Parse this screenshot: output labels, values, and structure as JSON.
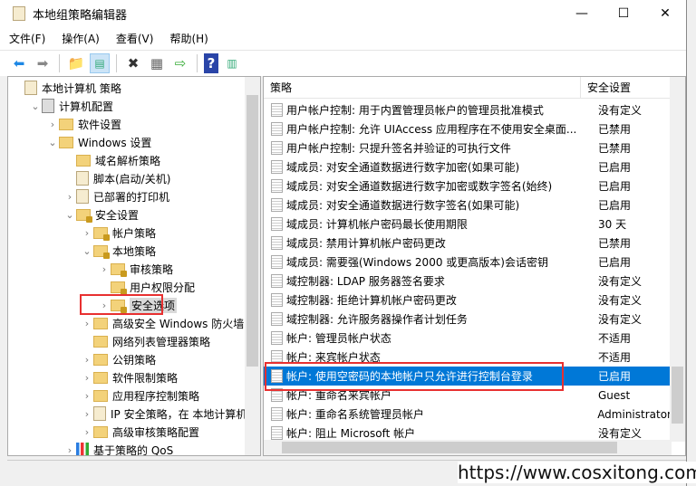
{
  "window": {
    "title": "本地组策略编辑器",
    "minimize": "—",
    "maximize": "☐",
    "close": "✕"
  },
  "menu": [
    "文件(F)",
    "操作(A)",
    "查看(V)",
    "帮助(H)"
  ],
  "toolbar": [
    "back-icon",
    "forward-icon",
    "up-folder-icon",
    "show-hide-tree-icon",
    "delete-icon",
    "properties-icon",
    "export-list-icon",
    "help-icon",
    "show-hide-action-pane-icon"
  ],
  "tree": [
    {
      "label": "本地计算机 策略",
      "level": 0,
      "chevron": "",
      "icon": "doc"
    },
    {
      "label": "计算机配置",
      "level": 1,
      "chevron": "expanded",
      "icon": "computer"
    },
    {
      "label": "软件设置",
      "level": 2,
      "chevron": "collapsed",
      "icon": "folder"
    },
    {
      "label": "Windows 设置",
      "level": 2,
      "chevron": "expanded",
      "icon": "folder"
    },
    {
      "label": "域名解析策略",
      "level": 3,
      "chevron": "",
      "icon": "folder"
    },
    {
      "label": "脚本(启动/关机)",
      "level": 3,
      "chevron": "",
      "icon": "script"
    },
    {
      "label": "已部署的打印机",
      "level": 3,
      "chevron": "collapsed",
      "icon": "printer"
    },
    {
      "label": "安全设置",
      "level": 3,
      "chevron": "expanded",
      "icon": "lockfolder"
    },
    {
      "label": "帐户策略",
      "level": 4,
      "chevron": "collapsed",
      "icon": "lockfolder"
    },
    {
      "label": "本地策略",
      "level": 4,
      "chevron": "expanded",
      "icon": "lockfolder"
    },
    {
      "label": "审核策略",
      "level": 5,
      "chevron": "collapsed",
      "icon": "lockfolder"
    },
    {
      "label": "用户权限分配",
      "level": 5,
      "chevron": "",
      "icon": "lockfolder"
    },
    {
      "label": "安全选项",
      "level": 5,
      "chevron": "collapsed",
      "icon": "lockfolder",
      "selected": true
    },
    {
      "label": "高级安全 Windows 防火墙",
      "level": 4,
      "chevron": "collapsed",
      "icon": "folder"
    },
    {
      "label": "网络列表管理器策略",
      "level": 4,
      "chevron": "",
      "icon": "folder"
    },
    {
      "label": "公钥策略",
      "level": 4,
      "chevron": "collapsed",
      "icon": "folder"
    },
    {
      "label": "软件限制策略",
      "level": 4,
      "chevron": "collapsed",
      "icon": "folder"
    },
    {
      "label": "应用程序控制策略",
      "level": 4,
      "chevron": "collapsed",
      "icon": "folder"
    },
    {
      "label": "IP 安全策略，在 本地计算机",
      "level": 4,
      "chevron": "collapsed",
      "icon": "ipsec"
    },
    {
      "label": "高级审核策略配置",
      "level": 4,
      "chevron": "collapsed",
      "icon": "folder"
    },
    {
      "label": "基于策略的 QoS",
      "level": 3,
      "chevron": "collapsed",
      "icon": "chart"
    }
  ],
  "list": {
    "columns": [
      "策略",
      "安全设置"
    ],
    "rows": [
      {
        "name": "用户帐户控制: 用于内置管理员帐户的管理员批准模式",
        "value": "没有定义"
      },
      {
        "name": "用户帐户控制: 允许 UIAccess 应用程序在不使用安全桌面...",
        "value": "已禁用"
      },
      {
        "name": "用户帐户控制: 只提升签名并验证的可执行文件",
        "value": "已禁用"
      },
      {
        "name": "域成员: 对安全通道数据进行数字加密(如果可能)",
        "value": "已启用"
      },
      {
        "name": "域成员: 对安全通道数据进行数字加密或数字签名(始终)",
        "value": "已启用"
      },
      {
        "name": "域成员: 对安全通道数据进行数字签名(如果可能)",
        "value": "已启用"
      },
      {
        "name": "域成员: 计算机帐户密码最长使用期限",
        "value": "30 天"
      },
      {
        "name": "域成员: 禁用计算机帐户密码更改",
        "value": "已禁用"
      },
      {
        "name": "域成员: 需要强(Windows 2000 或更高版本)会话密钥",
        "value": "已启用"
      },
      {
        "name": "域控制器: LDAP 服务器签名要求",
        "value": "没有定义"
      },
      {
        "name": "域控制器: 拒绝计算机帐户密码更改",
        "value": "没有定义"
      },
      {
        "name": "域控制器: 允许服务器操作者计划任务",
        "value": "没有定义"
      },
      {
        "name": "帐户: 管理员帐户状态",
        "value": "不适用"
      },
      {
        "name": "帐户: 来宾帐户状态",
        "value": "不适用"
      },
      {
        "name": "帐户: 使用空密码的本地帐户只允许进行控制台登录",
        "value": "已启用",
        "selected": true
      },
      {
        "name": "帐户: 重命名来宾帐户",
        "value": "Guest"
      },
      {
        "name": "帐户: 重命名系统管理员帐户",
        "value": "Administrator"
      },
      {
        "name": "帐户: 阻止 Microsoft 帐户",
        "value": "没有定义"
      }
    ]
  },
  "watermark": "https://www.cosxitong.com",
  "colors": {
    "selection": "#0078d7",
    "highlight_box": "#e83030"
  }
}
